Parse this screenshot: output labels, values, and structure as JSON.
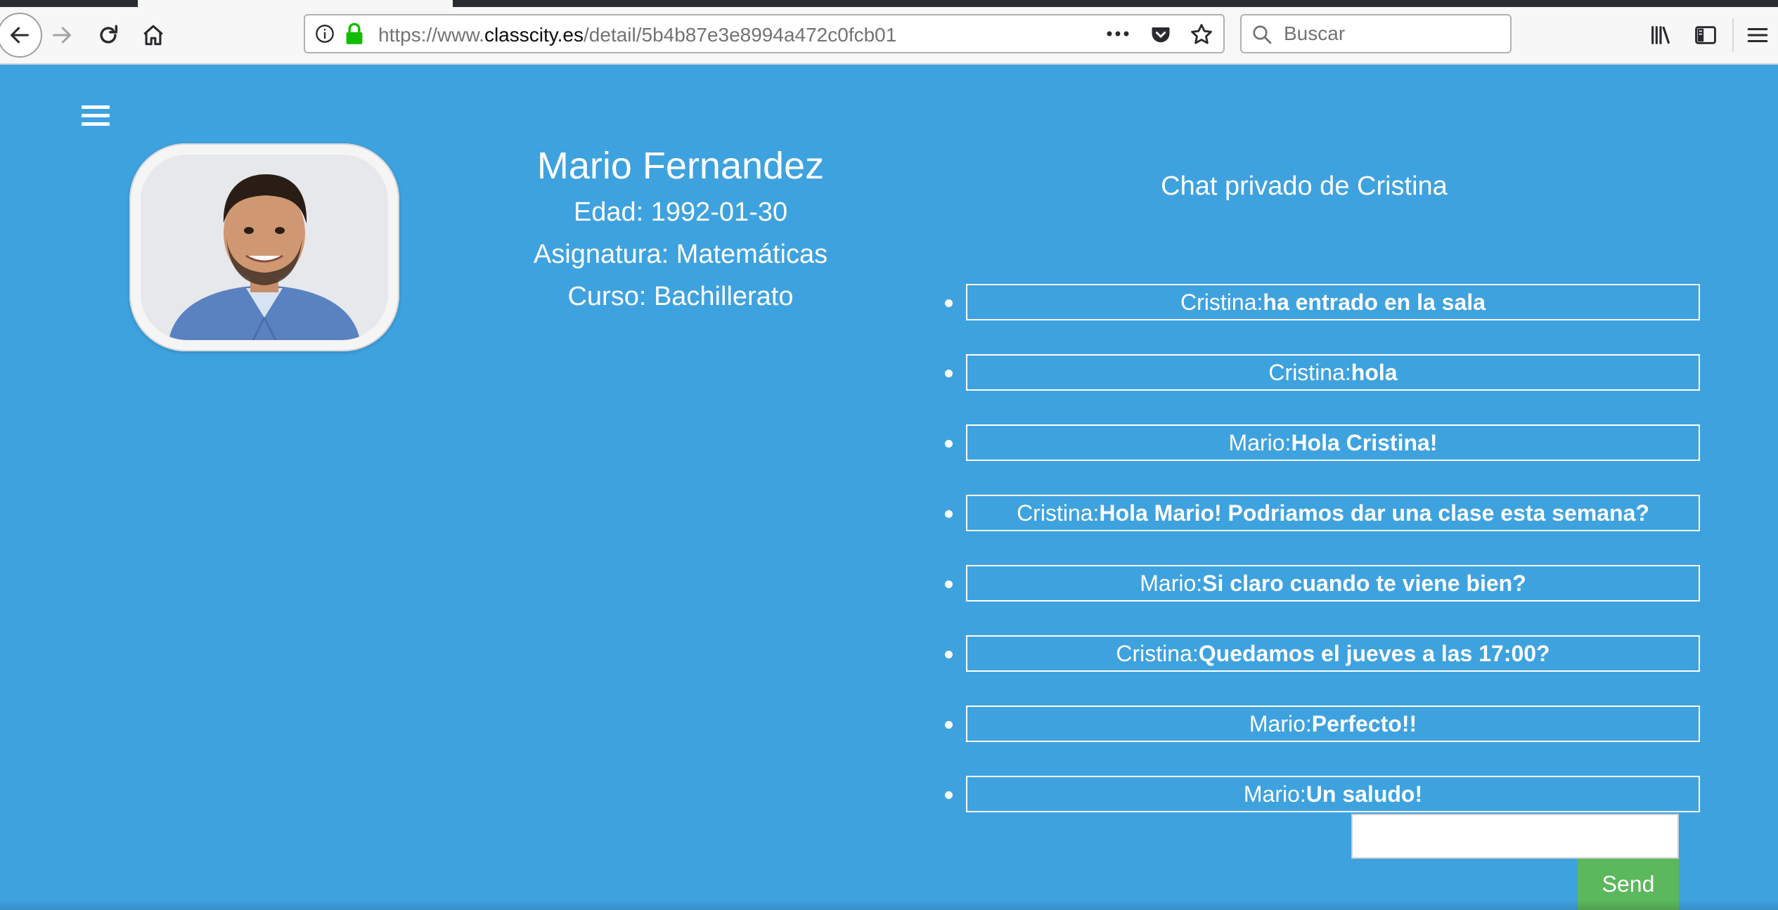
{
  "browser": {
    "url_prefix": "https://www.",
    "url_domain": "classcity.es",
    "url_path": "/detail/5b4b87e3e8994a472c0fcb01",
    "search_placeholder": "Buscar",
    "icons": [
      "back-icon",
      "forward-icon",
      "reload-icon",
      "home-icon",
      "info-icon",
      "lock-icon",
      "page-actions-icon",
      "pocket-icon",
      "bookmark-star-icon",
      "search-icon",
      "library-icon",
      "sidebar-icon",
      "menu-icon"
    ]
  },
  "profile": {
    "name": "Mario Fernandez",
    "age_line": "Edad: 1992-01-30",
    "subject_line": "Asignatura: Matemáticas",
    "course_line": "Curso: Bachillerato"
  },
  "chat": {
    "title": "Chat privado de Cristina",
    "messages": [
      {
        "sender": "Cristina:",
        "text": "ha entrado en la sala"
      },
      {
        "sender": "Cristina:",
        "text": "hola"
      },
      {
        "sender": "Mario:",
        "text": "Hola Cristina!"
      },
      {
        "sender": "Cristina:",
        "text": "Hola Mario! Podriamos dar una clase esta semana?"
      },
      {
        "sender": "Mario:",
        "text": "Si claro cuando te viene bien?"
      },
      {
        "sender": "Cristina:",
        "text": "Quedamos el jueves a las 17:00?"
      },
      {
        "sender": "Mario:",
        "text": "Perfecto!!"
      },
      {
        "sender": "Mario:",
        "text": "Un saludo!"
      }
    ],
    "input_value": "",
    "send_label": "Send"
  },
  "colors": {
    "page_background": "#3ea2df",
    "send_button": "#5cb85c",
    "lock_green": "#12bc00"
  }
}
